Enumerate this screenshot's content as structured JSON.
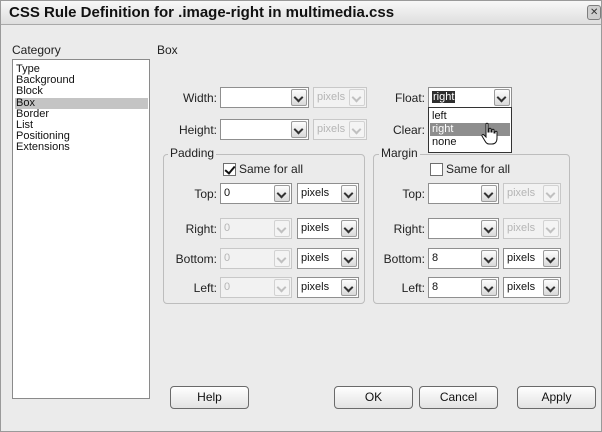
{
  "window": {
    "title": "CSS Rule Definition for .image-right in multimedia.css"
  },
  "category": {
    "heading": "Category",
    "items": [
      "Type",
      "Background",
      "Block",
      "Box",
      "Border",
      "List",
      "Positioning",
      "Extensions"
    ],
    "selected": "Box"
  },
  "panel": {
    "heading": "Box",
    "width": {
      "label": "Width:",
      "value": "",
      "unit": "pixels"
    },
    "height": {
      "label": "Height:",
      "value": "",
      "unit": "pixels"
    },
    "float": {
      "label": "Float:",
      "value": "right",
      "options": [
        "left",
        "right",
        "none"
      ],
      "highlighted": "right"
    },
    "clear": {
      "label": "Clear:"
    },
    "padding": {
      "legend": "Padding",
      "same_for_all": {
        "label": "Same for all",
        "checked": true
      },
      "top": {
        "label": "Top:",
        "value": "0",
        "unit": "pixels"
      },
      "right": {
        "label": "Right:",
        "value": "0",
        "unit": "pixels"
      },
      "bottom": {
        "label": "Bottom:",
        "value": "0",
        "unit": "pixels"
      },
      "left": {
        "label": "Left:",
        "value": "0",
        "unit": "pixels"
      }
    },
    "margin": {
      "legend": "Margin",
      "same_for_all": {
        "label": "Same for all",
        "checked": false
      },
      "top": {
        "label": "Top:",
        "value": "",
        "unit": "pixels"
      },
      "right": {
        "label": "Right:",
        "value": "",
        "unit": "pixels"
      },
      "bottom": {
        "label": "Bottom:",
        "value": "8",
        "unit": "pixels"
      },
      "left": {
        "label": "Left:",
        "value": "8",
        "unit": "pixels"
      }
    }
  },
  "buttons": {
    "help": "Help",
    "ok": "OK",
    "cancel": "Cancel",
    "apply": "Apply"
  }
}
